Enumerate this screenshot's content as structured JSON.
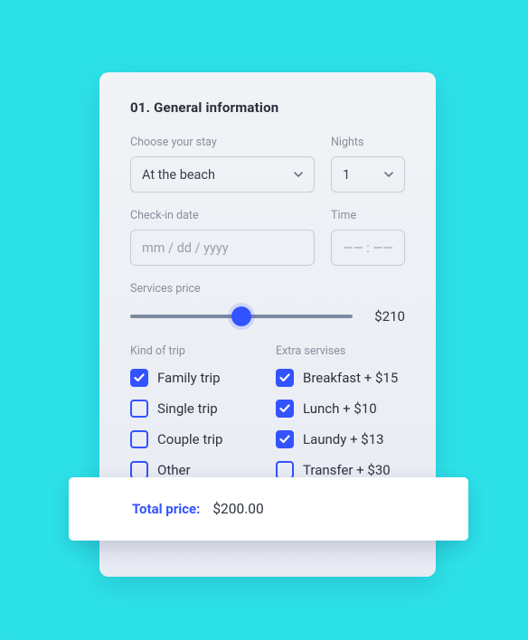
{
  "section_title": "01. General information",
  "stay": {
    "label": "Choose your stay",
    "value": "At the beach"
  },
  "nights": {
    "label": "Nights",
    "value": "1"
  },
  "checkin": {
    "label": "Check-in date",
    "placeholder": "mm / dd / yyyy"
  },
  "time": {
    "label": "Time",
    "placeholder": "—— : ——"
  },
  "services": {
    "label": "Services price",
    "value": "$210",
    "percent": 50
  },
  "trip_col_title": "Kind of trip",
  "extras_col_title": "Extra servises",
  "trips": [
    {
      "label": "Family trip",
      "checked": true
    },
    {
      "label": "Single trip",
      "checked": false
    },
    {
      "label": "Couple trip",
      "checked": false
    },
    {
      "label": "Other",
      "checked": false
    }
  ],
  "extras": [
    {
      "label": "Breakfast + $15",
      "checked": true
    },
    {
      "label": "Lunch + $10",
      "checked": true
    },
    {
      "label": "Laundy + $13",
      "checked": true
    },
    {
      "label": "Transfer + $30",
      "checked": false
    }
  ],
  "total": {
    "label": "Total price:",
    "value": "$200.00"
  }
}
